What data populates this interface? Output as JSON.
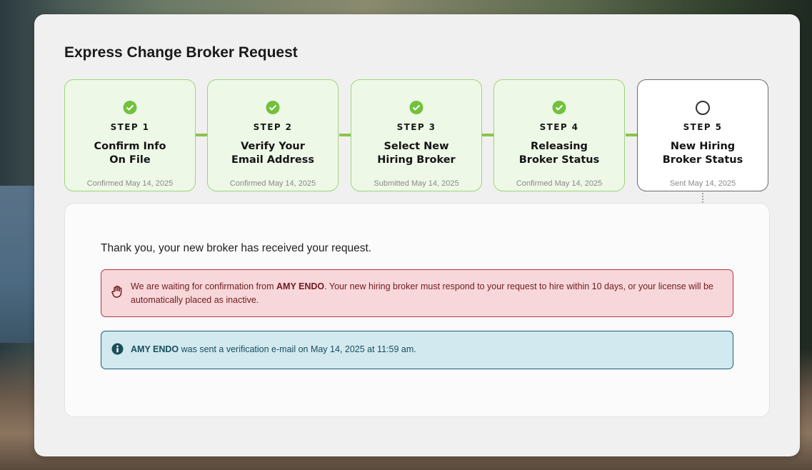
{
  "page": {
    "title": "Express Change Broker Request"
  },
  "steps": [
    {
      "label": "STEP 1",
      "name_line1": "Confirm Info",
      "name_line2": "On File",
      "date": "Confirmed May 14, 2025",
      "status": "complete"
    },
    {
      "label": "STEP 2",
      "name_line1": "Verify Your",
      "name_line2": "Email Address",
      "date": "Confirmed May 14, 2025",
      "status": "complete"
    },
    {
      "label": "STEP 3",
      "name_line1": "Select New",
      "name_line2": "Hiring Broker",
      "date": "Submitted May 14, 2025",
      "status": "complete"
    },
    {
      "label": "STEP 4",
      "name_line1": "Releasing",
      "name_line2": "Broker Status",
      "date": "Confirmed May 14, 2025",
      "status": "complete"
    },
    {
      "label": "STEP 5",
      "name_line1": "New Hiring",
      "name_line2": "Broker Status",
      "date": "Sent May 14, 2025",
      "status": "pending"
    }
  ],
  "main": {
    "thanks": "Thank you, your new broker has received your request.",
    "warning": {
      "prefix": "We are waiting for confirmation from ",
      "broker": "AMY ENDO",
      "suffix": ". Your new hiring broker must respond to your request to hire within 10 days, or your license will be automatically placed as inactive.",
      "icon": "hand-stop-icon"
    },
    "info": {
      "broker": "AMY ENDO",
      "suffix": " was sent a verification e-mail on May 14, 2025 at 11:59 am.",
      "icon": "info-circle-icon"
    }
  },
  "colors": {
    "step_complete_bg": "#eef8e7",
    "step_complete_border": "#9ed57a",
    "check_green": "#72c13c",
    "connector_green": "#8bc34a",
    "danger_bg": "#f8d7da",
    "danger_border": "#b5383f",
    "info_bg": "#d1e9ef",
    "info_border": "#1a5f73"
  }
}
